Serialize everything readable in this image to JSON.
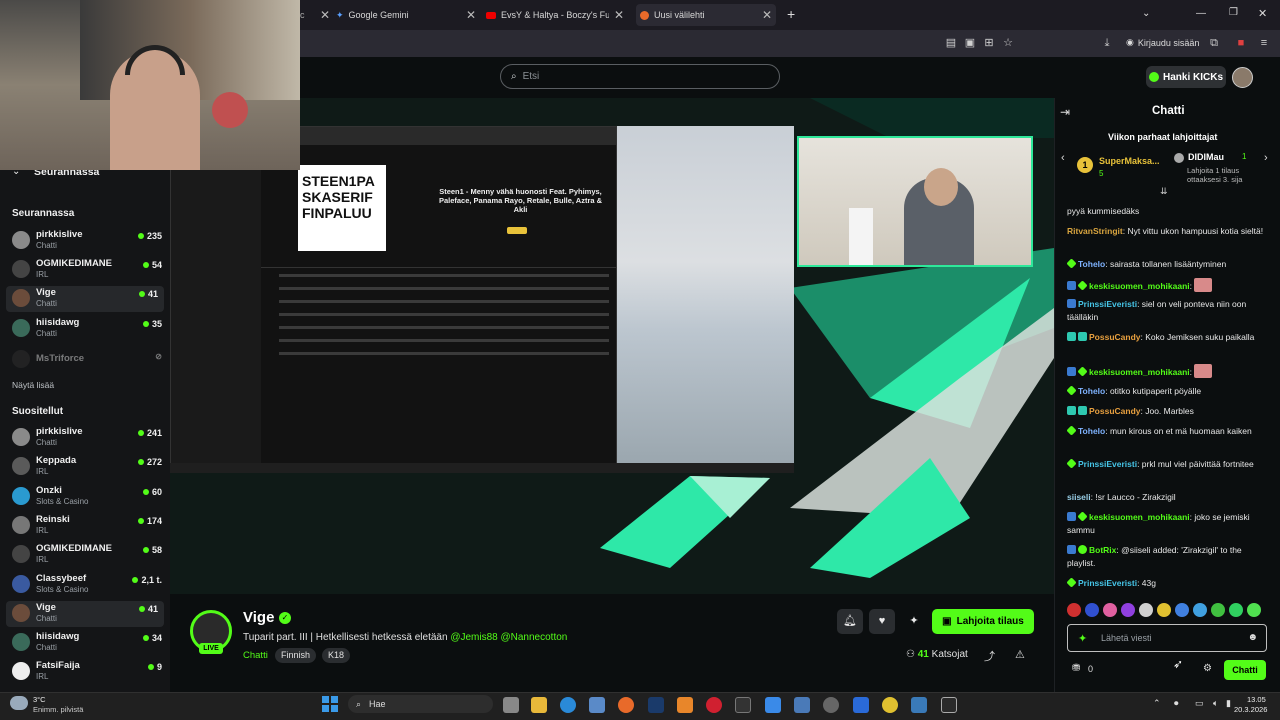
{
  "browser": {
    "tabs": [
      {
        "label": "Google Gemini"
      },
      {
        "label": "EvsY & Haltya - Boczy's Funky C"
      },
      {
        "label": "Uusi välilehti"
      }
    ],
    "new_tab": "+",
    "login_label": "Kirjaudu sisään"
  },
  "header": {
    "search_placeholder": "Etsi",
    "get_kicks_label": "Hanki KICKs"
  },
  "sidebar": {
    "following_title": "Seurannassa",
    "following_section": "Seurannassa",
    "following": [
      {
        "name": "pirkkislive",
        "sub": "Chatti",
        "count": "235",
        "color": "#8a8a8a"
      },
      {
        "name": "OGMIKEDIMANE",
        "sub": "IRL",
        "count": "54",
        "color": "#444"
      },
      {
        "name": "Vige",
        "sub": "Chatti",
        "count": "41",
        "color": "#6b4c3b"
      },
      {
        "name": "hiisidawg",
        "sub": "Chatti",
        "count": "35",
        "color": "#3a6a5a"
      },
      {
        "name": "MsTriforce",
        "sub": "",
        "count": "",
        "color": "#333"
      }
    ],
    "show_more": "Näytä lisää",
    "recommended_title": "Suositellut",
    "recommended": [
      {
        "name": "pirkkislive",
        "sub": "Chatti",
        "count": "241",
        "color": "#8a8a8a"
      },
      {
        "name": "Keppada",
        "sub": "IRL",
        "count": "272",
        "color": "#5a5a5a"
      },
      {
        "name": "Onzki",
        "sub": "Slots & Casino",
        "count": "60",
        "color": "#2a9ad0"
      },
      {
        "name": "Reinski",
        "sub": "IRL",
        "count": "174",
        "color": "#777"
      },
      {
        "name": "OGMIKEDIMANE",
        "sub": "IRL",
        "count": "58",
        "color": "#444"
      },
      {
        "name": "Classybeef",
        "sub": "Slots & Casino",
        "count": "2,1 t.",
        "color": "#3a5aa0"
      },
      {
        "name": "Vige",
        "sub": "Chatti",
        "count": "41",
        "color": "#6b4c3b"
      },
      {
        "name": "hiisidawg",
        "sub": "Chatti",
        "count": "34",
        "color": "#3a6a5a"
      },
      {
        "name": "FatsiFaija",
        "sub": "IRL",
        "count": "9",
        "color": "#eee"
      }
    ]
  },
  "screen": {
    "album_text": "STEEN1PA SKASERIF FINPALUU",
    "song_title": "Steen1 - Menny vähä huonosti Feat. Pyhimys, Paleface, Panama Rayo, Retale, Bulle, Aztra & Akli"
  },
  "stream": {
    "streamer": "Vige",
    "live": "LIVE",
    "title_text": "Tuparit part. III | Hetkellisesti hetkessä eletään ",
    "mention1": "@Jemis88",
    "mention2": "@Nannecotton",
    "category": "Chatti",
    "tags": [
      "Finnish",
      "K18"
    ],
    "subscribe_label": "Lahjoita tilaus",
    "viewers_count": "41",
    "viewers_label": "Katsojat"
  },
  "chat": {
    "title": "Chatti",
    "gifters_title": "Viikon parhaat lahjoittajat",
    "gifter1_name": "SuperMaksa...",
    "gifter1_count": "5",
    "gifter2_name": "DIDIMau",
    "gifter2_count": "1",
    "gifter2_note": "Lahjoita 1 tilaus ottaaksesi 3. sija",
    "messages": [
      {
        "user": "",
        "text": "pyyä kummisedäks",
        "color": "#e8e8e8"
      },
      {
        "user": "RitvanStringit",
        "text": ": Nyt vittu ukon hampuusi kotia sieltä!",
        "color": "#d9a53f"
      },
      {
        "user": "Tohelo",
        "text": ": sairasta tollanen lisääntyminen",
        "color": "#7fb3ff"
      },
      {
        "user": "keskisuomen_mohikaani",
        "text": ":",
        "color": "#53fc18"
      },
      {
        "user": "PrinssiEveristi",
        "text": ": siel on veli ponteva niin oon täälläkin",
        "color": "#46c5e8"
      },
      {
        "user": "PossuCandy",
        "text": ": Koko Jemiksen suku paikalla",
        "color": "#e8a03f"
      },
      {
        "user": "keskisuomen_mohikaani",
        "text": ":",
        "color": "#53fc18"
      },
      {
        "user": "Tohelo",
        "text": ": otitko kutipaperit pöyälle",
        "color": "#7fb3ff"
      },
      {
        "user": "PossuCandy",
        "text": ": Joo. Marbles",
        "color": "#e8a03f"
      },
      {
        "user": "Tohelo",
        "text": ": mun kirous on et mä huomaan kaiken",
        "color": "#7fb3ff"
      },
      {
        "user": "PrinssiEveristi",
        "text": ": prkl mul viel päivittää fortnitee",
        "color": "#46c5e8"
      },
      {
        "user": "siiseli",
        "text": ": !sr Laucco - Zirakzigil",
        "color": "#9ad0e8"
      },
      {
        "user": "keskisuomen_mohikaani",
        "text": ": joko se jemiski sammu",
        "color": "#53fc18"
      },
      {
        "user": "BotRix",
        "text": ": @siiseli added: 'Zirakzigil' to the playlist.",
        "color": "#53fc18"
      },
      {
        "user": "PrinssiEveristi",
        "text": ": 43g",
        "color": "#46c5e8"
      }
    ],
    "input_placeholder": "Lähetä viesti",
    "points": "0",
    "send_label": "Chatti"
  },
  "taskbar": {
    "weather_temp": "3°C",
    "weather_desc": "Enimm. pilvistä",
    "search_label": "Hae",
    "time": "13.05",
    "date": "20.3.2026"
  }
}
